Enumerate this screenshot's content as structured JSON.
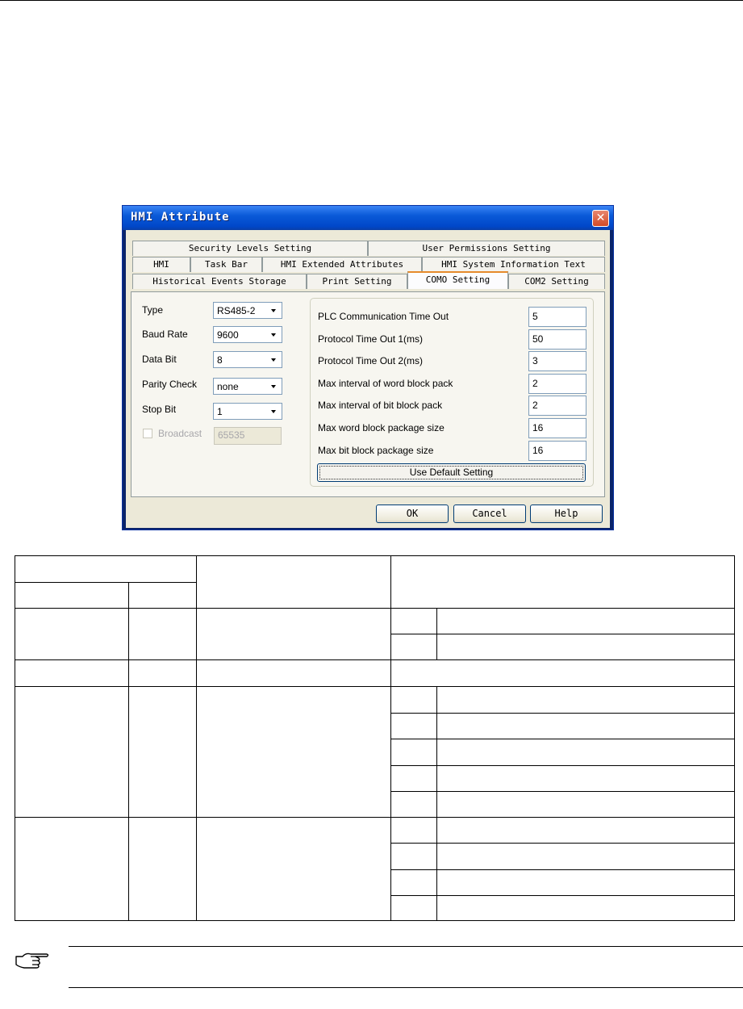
{
  "dialog": {
    "title": "HMI Attribute",
    "close_glyph": "✕",
    "tabs_row1": [
      "Security Levels Setting",
      "User Permissions Setting"
    ],
    "tabs_row2": [
      "HMI",
      "Task Bar",
      "HMI Extended Attributes",
      "HMI System Information Text"
    ],
    "tabs_row3": [
      "Historical Events Storage",
      "Print Setting",
      "COMO Setting",
      "COM2 Setting"
    ],
    "left": {
      "type_label": "Type",
      "type_value": "RS485-2",
      "baud_label": "Baud Rate",
      "baud_value": "9600",
      "databit_label": "Data Bit",
      "databit_value": "8",
      "parity_label": "Parity Check",
      "parity_value": "none",
      "stopbit_label": "Stop Bit",
      "stopbit_value": "1",
      "broadcast_label": "Broadcast",
      "broadcast_value": "65535"
    },
    "right": {
      "rows": [
        {
          "label": "PLC Communication Time Out",
          "value": "5"
        },
        {
          "label": "Protocol Time Out 1(ms)",
          "value": "50"
        },
        {
          "label": "Protocol Time Out 2(ms)",
          "value": "3"
        },
        {
          "label": "Max interval of word block pack",
          "value": "2"
        },
        {
          "label": "Max interval of bit block pack",
          "value": "2"
        },
        {
          "label": "Max word block package size",
          "value": "16"
        },
        {
          "label": "Max bit block package size",
          "value": "16"
        }
      ],
      "default_button": "Use Default Setting"
    },
    "buttons": {
      "ok": "OK",
      "cancel": "Cancel",
      "help": "Help"
    }
  },
  "icons": {
    "note": "pointing-hand-icon",
    "dropdown": "chevron-down-icon",
    "close": "close-icon"
  }
}
